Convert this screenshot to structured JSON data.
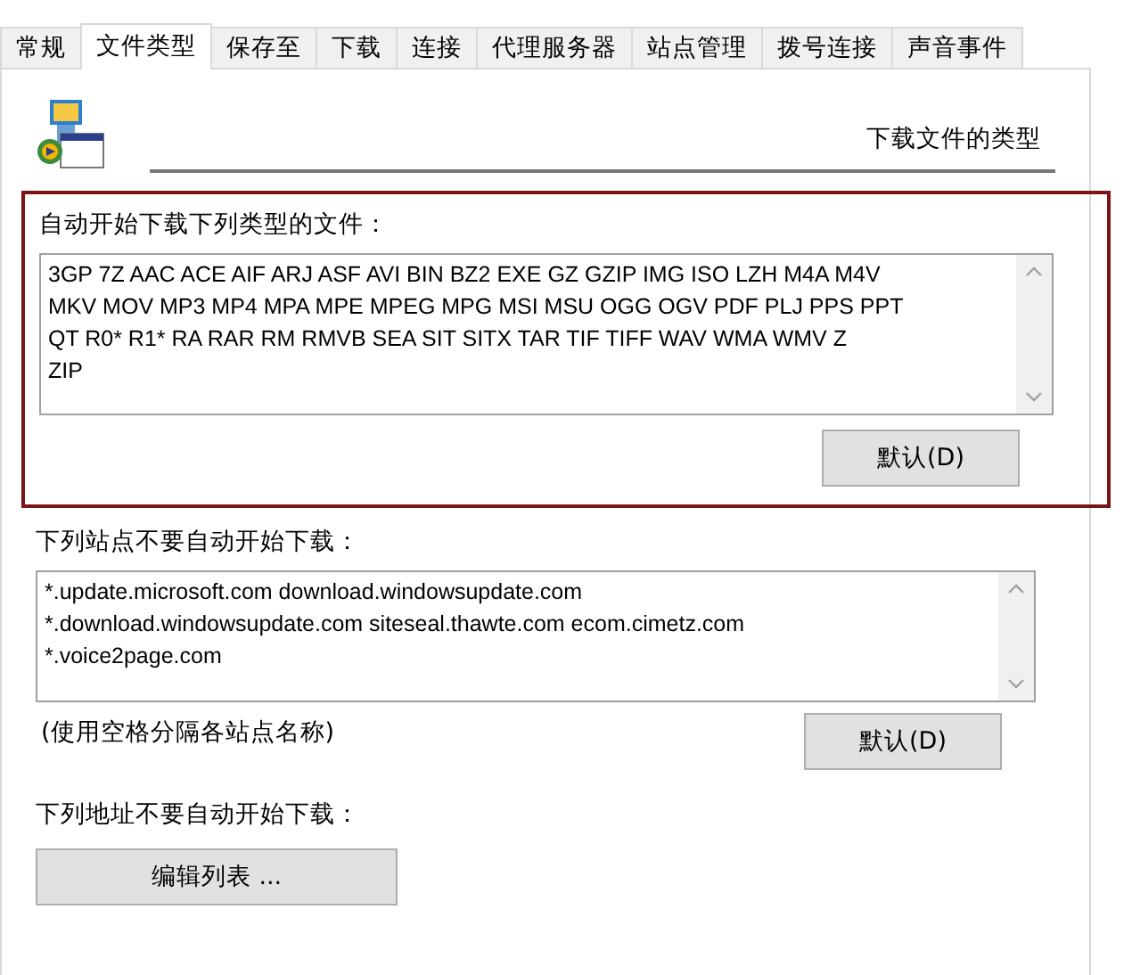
{
  "tabs": [
    {
      "label": "常规",
      "selected": false
    },
    {
      "label": "文件类型",
      "selected": true
    },
    {
      "label": "保存至",
      "selected": false
    },
    {
      "label": "下载",
      "selected": false
    },
    {
      "label": "连接",
      "selected": false
    },
    {
      "label": "代理服务器",
      "selected": false
    },
    {
      "label": "站点管理",
      "selected": false
    },
    {
      "label": "拨号连接",
      "selected": false
    },
    {
      "label": "声音事件",
      "selected": false
    }
  ],
  "header": {
    "title": "下载文件的类型"
  },
  "file_types": {
    "label": "自动开始下载下列类型的文件：",
    "lines": [
      "3GP 7Z AAC ACE AIF ARJ ASF AVI BIN BZ2 EXE GZ GZIP IMG ISO LZH M4A M4V",
      "MKV MOV MP3 MP4 MPA MPE MPEG MPG MSI MSU OGG OGV PDF PLJ PPS PPT",
      "QT R0* R1* RA RAR RM RMVB SEA SIT SITX TAR TIF TIFF WAV WMA WMV Z",
      "ZIP"
    ],
    "button": "默认(D)",
    "highlighted": true
  },
  "excluded_sites": {
    "label": "下列站点不要自动开始下载：",
    "lines": [
      "*.update.microsoft.com download.windowsupdate.com",
      "*.download.windowsupdate.com siteseal.thawte.com ecom.cimetz.com",
      "*.voice2page.com"
    ],
    "hint": "(使用空格分隔各站点名称)",
    "button": "默认(D)"
  },
  "excluded_addresses": {
    "label": "下列地址不要自动开始下载：",
    "button": "编辑列表 ..."
  }
}
